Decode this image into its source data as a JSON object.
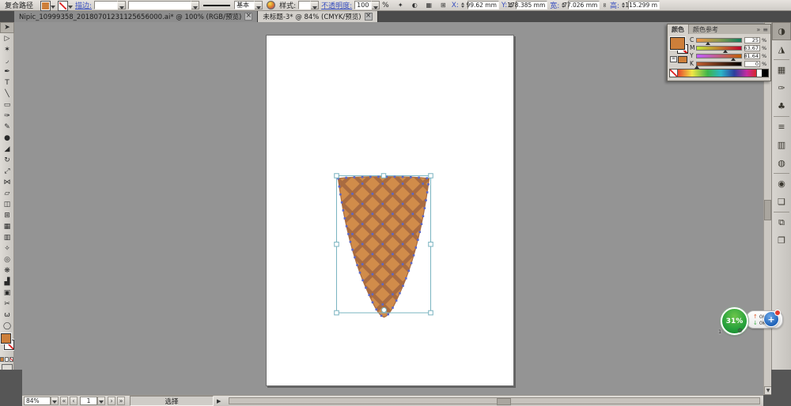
{
  "control_bar": {
    "object_label": "复合路径",
    "stroke_label": "描边:",
    "basic_label": "基本",
    "style_label": "样式:",
    "opacity_label": "不透明度:",
    "opacity_value": "100",
    "percent_sign": "%",
    "x_label": "X:",
    "x_value": "99.62 mm",
    "y_label": "Y:",
    "y_value": "178.385 mm",
    "width_label": "宽:",
    "width_value": "77.026 mm",
    "height_label": "高:",
    "height_value": "115.299 m"
  },
  "tab_bar": {
    "tabs": [
      {
        "title": "Nipic_10999358_20180701231125656000.ai* @ 100% (RGB/预览)",
        "close": "×",
        "active": false
      },
      {
        "title": "未标题-3* @ 84% (CMYK/预览)",
        "close": "×",
        "active": true
      }
    ]
  },
  "toolbar": {
    "tools": [
      {
        "name": "selection",
        "glyph": "➤",
        "active": true
      },
      {
        "name": "direct-selection",
        "glyph": "▷",
        "active": false
      },
      {
        "name": "magic-wand",
        "glyph": "✶",
        "active": false
      },
      {
        "name": "lasso",
        "glyph": "◞",
        "active": false
      },
      {
        "name": "pen",
        "glyph": "✒",
        "active": false
      },
      {
        "name": "type",
        "glyph": "T",
        "active": false
      },
      {
        "name": "line-segment",
        "glyph": "╲",
        "active": false
      },
      {
        "name": "rectangle",
        "glyph": "▭",
        "active": false
      },
      {
        "name": "paintbrush",
        "glyph": "✑",
        "active": false
      },
      {
        "name": "pencil",
        "glyph": "✎",
        "active": false
      },
      {
        "name": "blob-brush",
        "glyph": "●",
        "active": false
      },
      {
        "name": "eraser",
        "glyph": "◢",
        "active": false
      },
      {
        "name": "rotate",
        "glyph": "↻",
        "active": false
      },
      {
        "name": "scale",
        "glyph": "⤢",
        "active": false
      },
      {
        "name": "width",
        "glyph": "⋈",
        "active": false
      },
      {
        "name": "free-transform",
        "glyph": "▱",
        "active": false
      },
      {
        "name": "shape-builder",
        "glyph": "◫",
        "active": false
      },
      {
        "name": "perspective-grid",
        "glyph": "⊞",
        "active": false
      },
      {
        "name": "mesh",
        "glyph": "▦",
        "active": false
      },
      {
        "name": "gradient",
        "glyph": "▥",
        "active": false
      },
      {
        "name": "eyedropper",
        "glyph": "✧",
        "active": false
      },
      {
        "name": "blend",
        "glyph": "◎",
        "active": false
      },
      {
        "name": "symbol-sprayer",
        "glyph": "❋",
        "active": false
      },
      {
        "name": "column-graph",
        "glyph": "▟",
        "active": false
      },
      {
        "name": "artboard",
        "glyph": "▣",
        "active": false
      },
      {
        "name": "slice",
        "glyph": "✂",
        "active": false
      },
      {
        "name": "hand",
        "glyph": "ω",
        "active": false
      },
      {
        "name": "zoom",
        "glyph": "◯",
        "active": false
      }
    ]
  },
  "color_panel": {
    "tab_color": "颜色",
    "tab_color_guide": "颜色参考",
    "collapse_icon": "»",
    "menu_icon": "≡",
    "channels": [
      {
        "label": "C",
        "value": "25",
        "unit": "%",
        "pos": 25
      },
      {
        "label": "M",
        "value": "63.67",
        "unit": "%",
        "pos": 63.67
      },
      {
        "label": "Y",
        "value": "81.64",
        "unit": "%",
        "pos": 81.64
      },
      {
        "label": "K",
        "value": "0",
        "unit": "%",
        "pos": 0
      }
    ]
  },
  "dock": {
    "panels": [
      {
        "name": "color",
        "glyph": "◑",
        "active": true
      },
      {
        "name": "color-guide",
        "glyph": "◮",
        "active": false
      },
      {
        "name": "swatches",
        "glyph": "▦",
        "active": false
      },
      {
        "name": "brushes",
        "glyph": "✑",
        "active": false
      },
      {
        "name": "symbols",
        "glyph": "♣",
        "active": false
      },
      {
        "name": "stroke",
        "glyph": "≡",
        "active": false
      },
      {
        "name": "gradient",
        "glyph": "▥",
        "active": false
      },
      {
        "name": "transparency",
        "glyph": "◍",
        "active": false
      },
      {
        "name": "appearance",
        "glyph": "◉",
        "active": false
      },
      {
        "name": "graphic-styles",
        "glyph": "❏",
        "active": false
      },
      {
        "name": "layers",
        "glyph": "⧉",
        "active": false
      },
      {
        "name": "artboards",
        "glyph": "❐",
        "active": false
      }
    ]
  },
  "status_bar": {
    "zoom_value": "84%",
    "nav": {
      "first": "«",
      "prev": "‹",
      "next": "›",
      "last": "»"
    },
    "artboard_number": "1",
    "status_text": "选择",
    "status_arrow": "▶"
  },
  "net_widget": {
    "percent": "31%",
    "up_arrow": "↑",
    "up_speed": "0K/s",
    "down_arrow": "↓",
    "down_speed": "0K/s",
    "plus": "+",
    "badge_number": "1"
  },
  "icons": {
    "link_dimensions": "∞"
  },
  "colors": {
    "cone_light": "#d18c4a",
    "cone_dark": "#a96b40",
    "selection": "#7ab4c0",
    "anchor": "#5a66c8",
    "fill_orange": "#cd7f3a",
    "link_blue": "#3a50c0"
  }
}
